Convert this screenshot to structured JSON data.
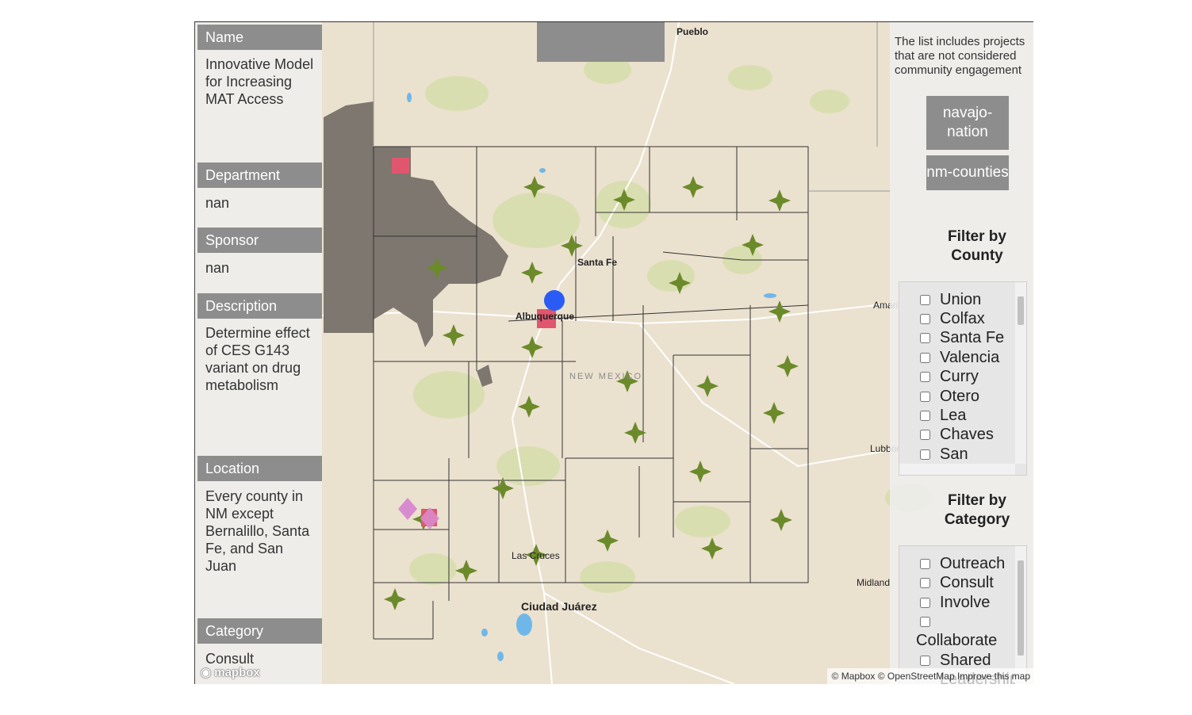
{
  "info": {
    "name_header": "Name",
    "name_value": "Innovative Model for Increasing MAT Access",
    "department_header": "Department",
    "department_value": "nan",
    "sponsor_header": "Sponsor",
    "sponsor_value": "nan",
    "description_header": "Description",
    "description_value": "Determine effect of CES G143 variant on drug metabolism",
    "location_header": "Location",
    "location_value": "Every county in NM except Bernalillo, Santa Fe, and San Juan",
    "category_header": "Category",
    "category_value": "Consult"
  },
  "sidebar": {
    "note": "The list includes projects that are not considered community engagement",
    "layer_buttons": [
      "navajo-nation",
      "nm-counties"
    ],
    "county_filter_title": "Filter by County",
    "counties": [
      "Union",
      "Colfax",
      "Santa Fe",
      "Valencia",
      "Curry",
      "Otero",
      "Lea",
      "Chaves",
      "San"
    ],
    "category_filter_title": "Filter by Category",
    "categories": [
      "Outreach",
      "Consult",
      "Involve",
      "Collaborate",
      "Shared Leadership"
    ]
  },
  "map": {
    "labels": {
      "pueblo": "Pueblo",
      "santa_fe": "Santa Fe",
      "albuquerque": "Albuquerque",
      "new_mexico": "NEW MEXICO",
      "amarillo": "Amarillo",
      "lubbock": "Lubbock",
      "las_cruces": "Las Cruces",
      "ciudad_juarez": "Ciudad Juárez",
      "midland": "Midland"
    },
    "attribution": "© Mapbox © OpenStreetMap Improve this map",
    "logo": "mapbox",
    "colors": {
      "base": "#ebe1cf",
      "parks": "#d9deb0",
      "water": "#6fb7e8",
      "navajo_nation": "#7d776f",
      "county_marker": "#6b8a2a",
      "square_marker": "#e0566e",
      "diamond_marker": "#d88cd0",
      "circle_marker": "#2a5cf5"
    }
  }
}
